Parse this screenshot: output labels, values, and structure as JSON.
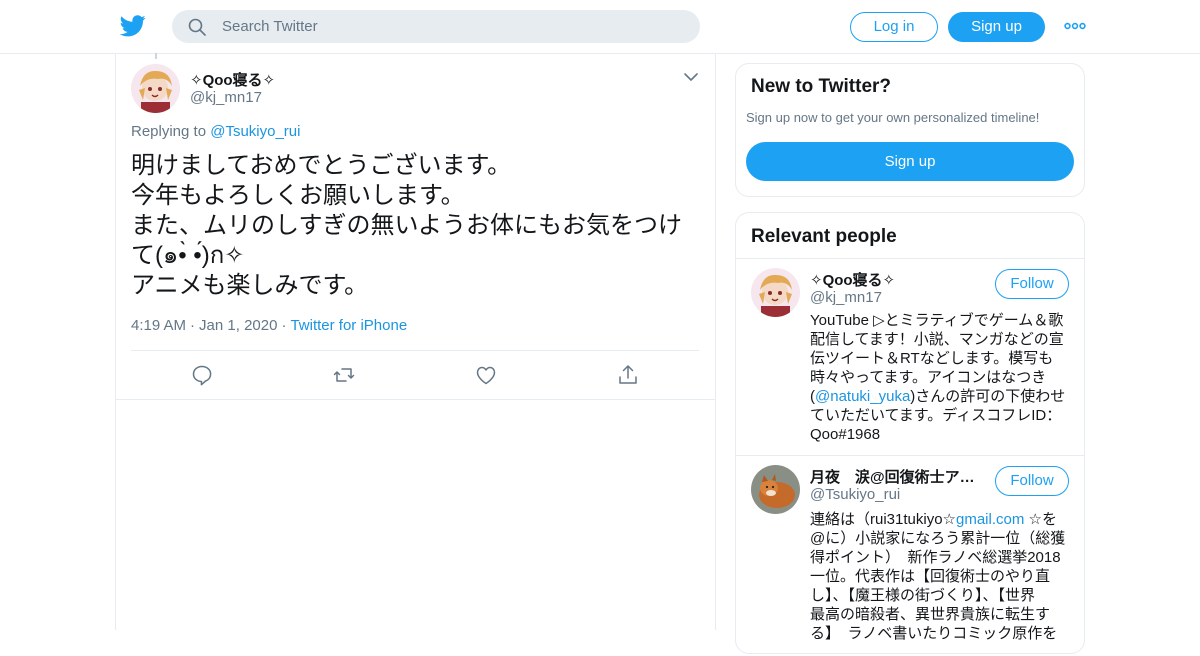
{
  "header": {
    "search_placeholder": "Search Twitter",
    "login_label": "Log in",
    "signup_label": "Sign up",
    "logo_icon": "twitter-bird-icon",
    "more_icon": "more-dots-icon",
    "brand_color": "#1da1f2"
  },
  "tweet": {
    "display_name": "✧Qoo寝る✧",
    "handle": "@kj_mn17",
    "replying_prefix": "Replying to",
    "replying_to": "@Tsukiyo_rui",
    "text_lines": [
      "明けましておめでとうございます。",
      "今年もよろしくお願いします。",
      "また、ムリのしすぎの無いようお体にもお気をつけ",
      "て(๑•̀ •́)ก✧",
      "アニメも楽しみです。"
    ],
    "time": "4:19 AM",
    "date": "Jan 1, 2020",
    "source": "Twitter for iPhone",
    "actions": [
      "reply-icon",
      "retweet-icon",
      "like-icon",
      "share-icon"
    ]
  },
  "new_to_twitter": {
    "title": "New to Twitter?",
    "subtitle": "Sign up now to get your own personalized timeline!",
    "signup_label": "Sign up"
  },
  "relevant_people": {
    "title": "Relevant people",
    "people": [
      {
        "display_name": "✧Qoo寝る✧",
        "handle": "@kj_mn17",
        "follow_label": "Follow",
        "bio_lines": [
          "YouTube ▷とミラティブでゲーム＆歌",
          "配信してます！小説、マンガなどの宣",
          "伝ツイート＆RTなどします。模写も",
          "時々やってます。アイコンはなつき"
        ],
        "bio_link_prefix": "(",
        "bio_link": "@natuki_yuka",
        "bio_link_suffix": ")さんの許可の下使わせ",
        "bio_tail_lines": [
          "ていただいてます。ディスコフレID：",
          "Qoo#1968"
        ]
      },
      {
        "display_name": "月夜　涙@回復術士ア…",
        "handle": "@Tsukiyo_rui",
        "follow_label": "Follow",
        "bio_first_prefix": "連絡は（rui31tukiyo☆",
        "bio_first_link": "gmail.com",
        "bio_first_suffix": " ☆を",
        "bio_lines": [
          "@に）小説家になろう累計一位（総獲",
          "得ポイント）　新作ラノベ総選挙2018",
          "一位。代表作は【回復術士のやり直",
          "し】、【魔王様の街づくり】、【世界",
          "最高の暗殺者、異世界貴族に転生す",
          "る】　ラノベ書いたりコミック原作を"
        ]
      }
    ]
  }
}
